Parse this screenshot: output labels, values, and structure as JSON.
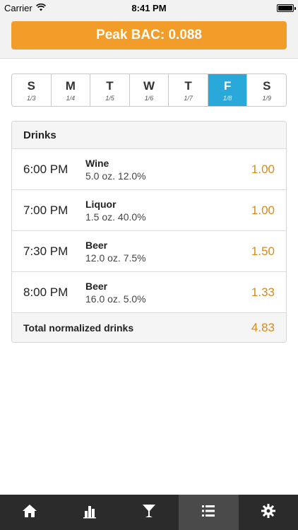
{
  "status_bar": {
    "carrier": "Carrier",
    "time": "8:41 PM"
  },
  "peak": {
    "label": "Peak BAC: 0.088",
    "color": "#f29d2a"
  },
  "days": [
    {
      "letter": "S",
      "date": "1/3",
      "active": false
    },
    {
      "letter": "M",
      "date": "1/4",
      "active": false
    },
    {
      "letter": "T",
      "date": "1/5",
      "active": false
    },
    {
      "letter": "W",
      "date": "1/6",
      "active": false
    },
    {
      "letter": "T",
      "date": "1/7",
      "active": false
    },
    {
      "letter": "F",
      "date": "1/8",
      "active": true
    },
    {
      "letter": "S",
      "date": "1/9",
      "active": false
    }
  ],
  "drinks": {
    "title": "Drinks",
    "rows": [
      {
        "time": "6:00 PM",
        "name": "Wine",
        "detail": "5.0 oz. 12.0%",
        "value": "1.00"
      },
      {
        "time": "7:00 PM",
        "name": "Liquor",
        "detail": "1.5 oz. 40.0%",
        "value": "1.00"
      },
      {
        "time": "7:30 PM",
        "name": "Beer",
        "detail": "12.0 oz. 7.5%",
        "value": "1.50"
      },
      {
        "time": "8:00 PM",
        "name": "Beer",
        "detail": "16.0 oz. 5.0%",
        "value": "1.33"
      }
    ],
    "total_label": "Total normalized drinks",
    "total_value": "4.83"
  },
  "tabs": [
    {
      "icon": "home-icon",
      "active": false
    },
    {
      "icon": "bar-chart-icon",
      "active": false
    },
    {
      "icon": "cocktail-glass-icon",
      "active": false
    },
    {
      "icon": "list-icon",
      "active": true
    },
    {
      "icon": "gear-icon",
      "active": false
    }
  ],
  "colors": {
    "accent_orange": "#f29d2a",
    "value_orange": "#d88a1b",
    "active_day_blue": "#29a9d9",
    "tabbar": "#2b2b2b"
  }
}
